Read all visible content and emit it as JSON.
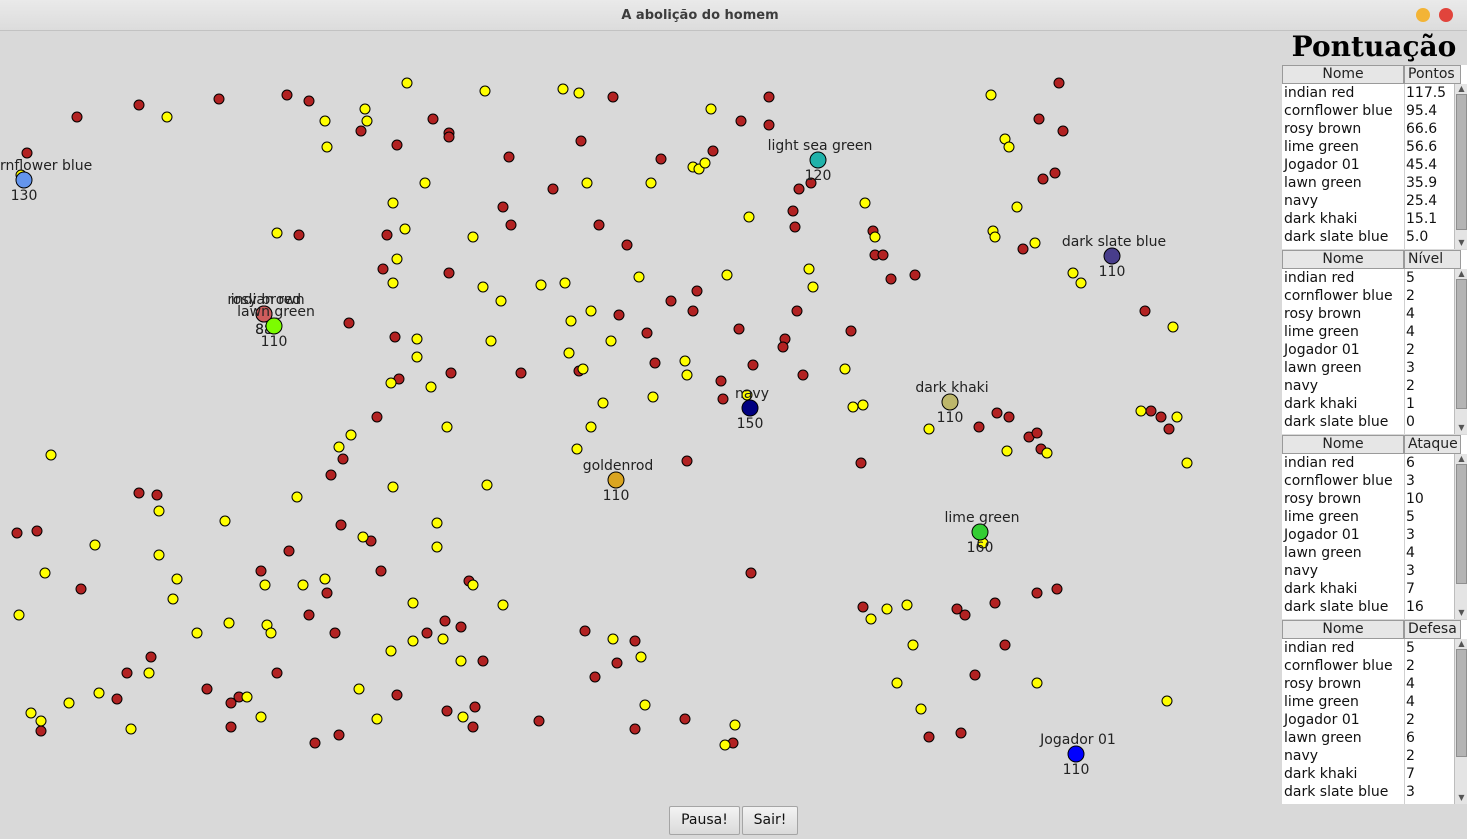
{
  "window": {
    "title": "A abolição do homem"
  },
  "scoreboard": {
    "title": "Pontuação"
  },
  "tables": [
    {
      "headers": [
        "Nome",
        "Pontos"
      ],
      "rows": [
        [
          "indian red",
          "117.5"
        ],
        [
          "cornflower blue",
          "95.4"
        ],
        [
          "rosy brown",
          "66.6"
        ],
        [
          "lime green",
          "56.6"
        ],
        [
          "Jogador 01",
          "45.4"
        ],
        [
          "lawn green",
          "35.9"
        ],
        [
          "navy",
          "25.4"
        ],
        [
          "dark khaki",
          "15.1"
        ],
        [
          "dark slate blue",
          "5.0"
        ]
      ]
    },
    {
      "headers": [
        "Nome",
        "Nível"
      ],
      "rows": [
        [
          "indian red",
          "5"
        ],
        [
          "cornflower blue",
          "2"
        ],
        [
          "rosy brown",
          "4"
        ],
        [
          "lime green",
          "4"
        ],
        [
          "Jogador 01",
          "2"
        ],
        [
          "lawn green",
          "3"
        ],
        [
          "navy",
          "2"
        ],
        [
          "dark khaki",
          "1"
        ],
        [
          "dark slate blue",
          "0"
        ]
      ]
    },
    {
      "headers": [
        "Nome",
        "Ataque"
      ],
      "rows": [
        [
          "indian red",
          "6"
        ],
        [
          "cornflower blue",
          "3"
        ],
        [
          "rosy brown",
          "10"
        ],
        [
          "lime green",
          "5"
        ],
        [
          "Jogador 01",
          "3"
        ],
        [
          "lawn green",
          "4"
        ],
        [
          "navy",
          "3"
        ],
        [
          "dark khaki",
          "7"
        ],
        [
          "dark slate blue",
          "16"
        ]
      ]
    },
    {
      "headers": [
        "Nome",
        "Defesa"
      ],
      "rows": [
        [
          "indian red",
          "5"
        ],
        [
          "cornflower blue",
          "2"
        ],
        [
          "rosy brown",
          "4"
        ],
        [
          "lime green",
          "4"
        ],
        [
          "Jogador 01",
          "2"
        ],
        [
          "lawn green",
          "6"
        ],
        [
          "navy",
          "2"
        ],
        [
          "dark khaki",
          "7"
        ],
        [
          "dark slate blue",
          "3"
        ]
      ]
    }
  ],
  "players": [
    {
      "name": "cornflower blue",
      "value": "130",
      "color": "#6495ed"
    },
    {
      "name": "light sea green",
      "value": "120",
      "color": "#20b2aa"
    },
    {
      "name": "dark slate blue",
      "value": "110",
      "color": "#483d8b"
    },
    {
      "name": "rosy brown",
      "value": "88",
      "color": "#bc8f8f"
    },
    {
      "name": "indian red",
      "value": "88",
      "color": "#cd5c5c"
    },
    {
      "name": "lawn green",
      "value": "110",
      "color": "#7cfc00"
    },
    {
      "name": "navy",
      "value": "150",
      "color": "#000080"
    },
    {
      "name": "dark khaki",
      "value": "110",
      "color": "#bdb76b"
    },
    {
      "name": "goldenrod",
      "value": "110",
      "color": "#daa520"
    },
    {
      "name": "lime green",
      "value": "160",
      "color": "#32cd32"
    },
    {
      "name": "Jogador 01",
      "value": "110",
      "color": "#0000ff"
    }
  ],
  "food_colors": {
    "food": "#ffff00",
    "poison": "#b22222",
    "outline": "#000000"
  },
  "controls": {
    "pause": "Pausa!",
    "quit": "Sair!"
  }
}
